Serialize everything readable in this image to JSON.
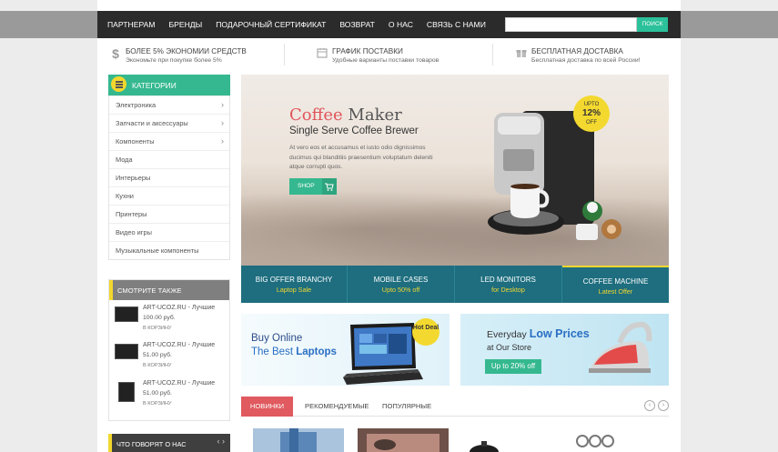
{
  "nav": {
    "items": [
      "ПАРТНЕРАМ",
      "БРЕНДЫ",
      "ПОДАРОЧНЫЙ СЕРТИФИКАТ",
      "ВОЗВРАТ",
      "О НАС",
      "СВЯЗЬ С НАМИ"
    ],
    "search_placeholder": "",
    "search_button": "ПОИСК"
  },
  "benefits": [
    {
      "icon": "dollar-icon",
      "title": "БОЛЕЕ 5% ЭКОНОМИИ СРЕДСТВ",
      "text": "Экономьте при покупке более 5%"
    },
    {
      "icon": "calendar-icon",
      "title": "ГРАФИК ПОСТАВКИ",
      "text": "Удобные варианты поставки товаров"
    },
    {
      "icon": "gift-icon",
      "title": "БЕСПЛАТНАЯ ДОСТАВКА",
      "text": "Бесплатная доставка по всей России!"
    }
  ],
  "categories": {
    "title": "КАТЕГОРИИ",
    "items": [
      {
        "label": "Электроника",
        "arrow": true
      },
      {
        "label": "Запчасти и аксессуары",
        "arrow": true
      },
      {
        "label": "Компоненты",
        "arrow": true
      },
      {
        "label": "Мода",
        "arrow": false
      },
      {
        "label": "Интерьеры",
        "arrow": false
      },
      {
        "label": "Кухни",
        "arrow": false
      },
      {
        "label": "Принтеры",
        "arrow": false
      },
      {
        "label": "Видео игры",
        "arrow": false
      },
      {
        "label": "Музыкальные компоненты",
        "arrow": false
      }
    ]
  },
  "see_also": {
    "title": "СМОТРИТЕ ТАКЖЕ",
    "items": [
      {
        "name": "ART-UCOZ.RU - Лучшие",
        "price": "100.00 руб.",
        "cart": "В КОРЗИНУ"
      },
      {
        "name": "ART-UCOZ.RU - Лучшие",
        "price": "51.00 руб.",
        "cart": "В КОРЗИНУ"
      },
      {
        "name": "ART-UCOZ.RU - Лучшие",
        "price": "51.00 руб.",
        "cart": "В КОРЗИНУ"
      }
    ]
  },
  "reviews": {
    "title": "ЧТО ГОВОРЯТ О НАС"
  },
  "hero": {
    "title_accent": "Coffee",
    "title_rest": " Maker",
    "subtitle": "Single Serve Coffee Brewer",
    "body": "At vero eos et accusamus et iusto odio dignissimos ducimus qui blanditiis praesentium voluptatum deleniti atque corrupti quos.",
    "button": "SHOP",
    "badge": {
      "top": "UPTO",
      "value": "12%",
      "bottom": "OFF"
    }
  },
  "hero_tabs": [
    {
      "title": "BIG OFFER BRANCHY",
      "sub": "Laptop Sale"
    },
    {
      "title": "MOBILE CASES",
      "sub": "Upto 50% off"
    },
    {
      "title": "LED MONITORS",
      "sub": "for Desktop"
    },
    {
      "title": "COFFEE MACHINE",
      "sub": "Latest Offer"
    }
  ],
  "promo_left": {
    "line1": "Buy Online",
    "line2_pre": "The Best ",
    "line2_bold": "Laptops",
    "badge": "Hot Deal"
  },
  "promo_right": {
    "line1_pre": "Everyday ",
    "line1_bold": "Low Prices",
    "line2": "at Our Store",
    "button": "Up to 20% off"
  },
  "product_tabs": [
    "НОВИНКИ",
    "РЕКОМЕНДУЕМЫЕ",
    "ПОПУЛЯРНЫЕ"
  ],
  "colors": {
    "accent_green": "#35b88f",
    "accent_yellow": "#f2d72e",
    "accent_red": "#e05a5f",
    "teal": "#1e6e7f"
  }
}
